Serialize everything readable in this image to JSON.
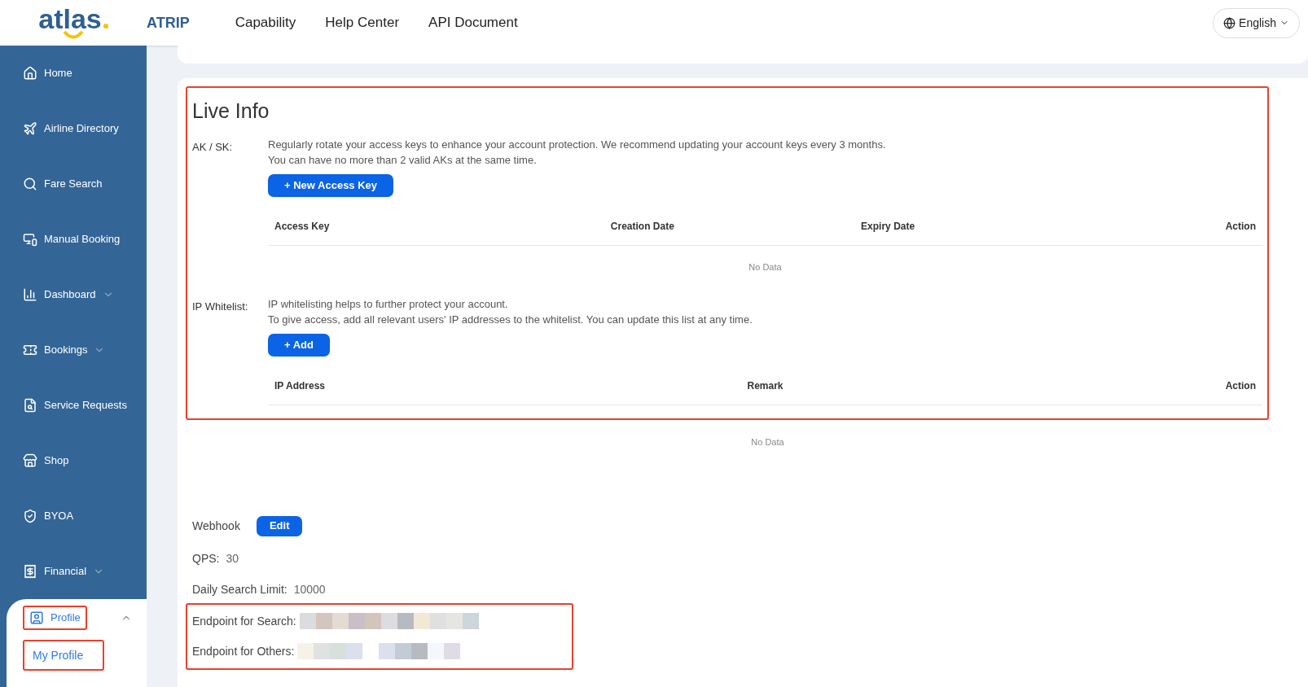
{
  "header": {
    "logo": "atlas",
    "brand": "ATRIP",
    "nav": [
      {
        "label": "Capability"
      },
      {
        "label": "Help Center"
      },
      {
        "label": "API Document"
      }
    ],
    "language": "English"
  },
  "sidebar": {
    "items": [
      {
        "label": "Home",
        "selected": false
      },
      {
        "label": "Airline Directory",
        "selected": false
      },
      {
        "label": "Fare Search",
        "selected": false
      },
      {
        "label": "Manual Booking",
        "selected": false
      },
      {
        "label": "Dashboard",
        "selected": false,
        "expanded": false
      },
      {
        "label": "Bookings",
        "selected": false,
        "expanded": false
      },
      {
        "label": "Service Requests",
        "selected": false
      },
      {
        "label": "Shop",
        "selected": false
      },
      {
        "label": "BYOA",
        "selected": false
      },
      {
        "label": "Financial",
        "selected": false,
        "expanded": false
      },
      {
        "label": "Profile",
        "selected": true,
        "expanded": true,
        "highlighted": true,
        "children": [
          {
            "label": "My Profile",
            "selected": true,
            "highlighted": true
          }
        ]
      }
    ]
  },
  "live_info": {
    "title": "Live Info",
    "highlighted": true,
    "ak_sk": {
      "label": "AK / SK:",
      "lines": [
        "Regularly rotate your access keys to enhance your account protection. We recommend updating your account keys every 3 months.",
        "You can have no more than 2 valid AKs at the same time."
      ],
      "button": "+ New Access Key",
      "columns": [
        "Access Key",
        "Creation Date",
        "Expiry Date",
        "Action"
      ],
      "empty": "No Data"
    },
    "ip_whitelist": {
      "label": "IP Whitelist:",
      "lines": [
        "IP whitelisting helps to further protect your account.",
        "To give access, add all relevant users' IP addresses to the whitelist. You can update this list at any time."
      ],
      "button": "+ Add",
      "columns": [
        "IP Address",
        "Remark",
        "Action"
      ],
      "empty": "No Data"
    }
  },
  "webhook": {
    "label": "Webhook",
    "button": "Edit"
  },
  "qps": {
    "label": "QPS:",
    "value": "30"
  },
  "daily_search_limit": {
    "label": "Daily Search Limit:",
    "value": "10000"
  },
  "endpoints": {
    "highlighted": true,
    "items": [
      {
        "label": "Endpoint for Search:"
      },
      {
        "label": "Endpoint for Others:"
      }
    ]
  }
}
